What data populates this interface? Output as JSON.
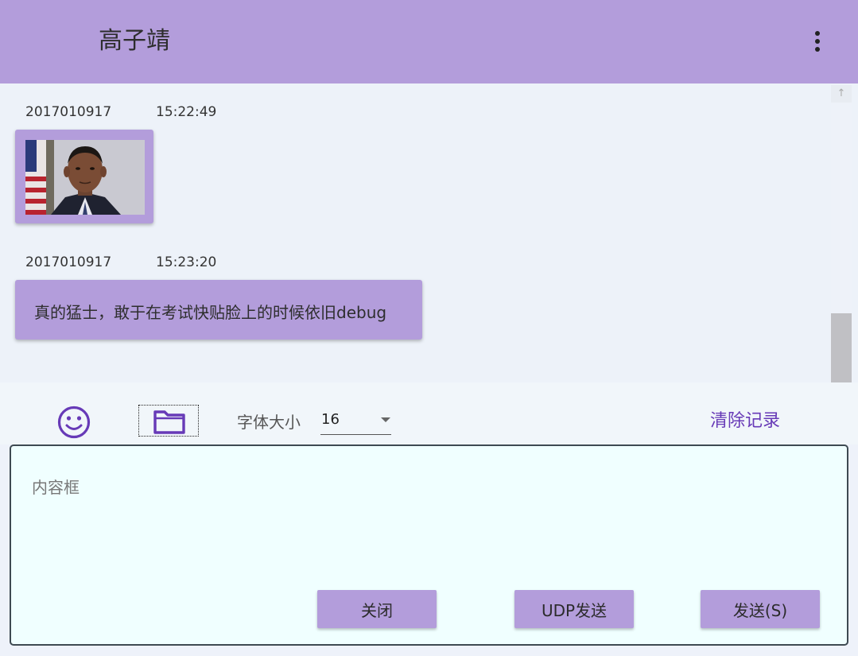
{
  "header": {
    "title": "高子靖",
    "menu_icon": "more-vertical-icon"
  },
  "messages": [
    {
      "sender": "2017010917",
      "time": "15:22:49",
      "type": "image",
      "image_desc": "portrait-photo"
    },
    {
      "sender": "2017010917",
      "time": "15:23:20",
      "type": "text",
      "text": "真的猛士，敢于在考试快贴脸上的时候依旧debug"
    }
  ],
  "toolbar": {
    "emoji_icon": "smiley-icon",
    "file_icon": "folder-icon",
    "font_size_label": "字体大小",
    "font_size_value": "16",
    "clear_label": "清除记录"
  },
  "composer": {
    "placeholder": "内容框",
    "value": "",
    "close_label": "关闭",
    "udp_send_label": "UDP发送",
    "send_label": "发送(S)"
  },
  "colors": {
    "accent": "#b39ddb",
    "accent_dark": "#673ab7",
    "chat_bg": "#edf2f9",
    "input_bg": "#f0ffff"
  }
}
